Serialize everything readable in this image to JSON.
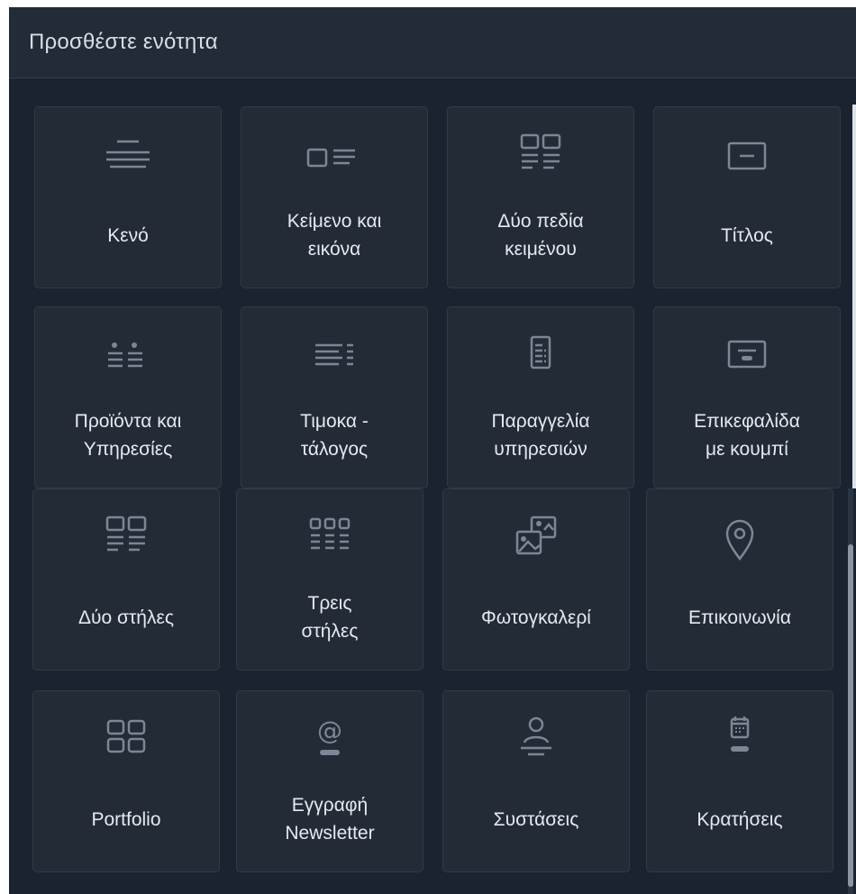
{
  "panel": {
    "title": "Προσθέστε ενότητα"
  },
  "tiles": [
    {
      "label": "Κενό",
      "icon": "blank-lines-icon"
    },
    {
      "label": "Κείμενο και\nεικόνα",
      "icon": "text-image-icon"
    },
    {
      "label": "Δύο πεδία\nκειμένου",
      "icon": "two-text-fields-icon"
    },
    {
      "label": "Τίτλος",
      "icon": "title-icon"
    },
    {
      "label": "Προϊόντα και\nΥπηρεσίες",
      "icon": "products-services-icon"
    },
    {
      "label": "Τιμοκα -\nτάλογος",
      "icon": "price-list-icon"
    },
    {
      "label": "Παραγγελία\nυπηρεσιών",
      "icon": "service-order-icon"
    },
    {
      "label": "Επικεφαλίδα\nμε κουμπί",
      "icon": "header-button-icon"
    },
    {
      "label": "Δύο στήλες",
      "icon": "two-columns-icon"
    },
    {
      "label": "Τρεις\nστήλες",
      "icon": "three-columns-icon"
    },
    {
      "label": "Φωτογκαλερί",
      "icon": "photo-gallery-icon"
    },
    {
      "label": "Επικοινωνία",
      "icon": "location-pin-icon"
    },
    {
      "label": "Portfolio",
      "icon": "portfolio-grid-icon"
    },
    {
      "label": "Εγγραφή\nNewsletter",
      "icon": "newsletter-at-icon"
    },
    {
      "label": "Συστάσεις",
      "icon": "testimonials-person-icon"
    },
    {
      "label": "Κρατήσεις",
      "icon": "bookings-calendar-icon"
    }
  ],
  "colors": {
    "panel_bg": "#1c2330",
    "header_bg": "#222b38",
    "tile_bg": "#232b37",
    "tile_border": "#313a48",
    "icon": "#7d8696",
    "text": "#e6e9ee"
  }
}
